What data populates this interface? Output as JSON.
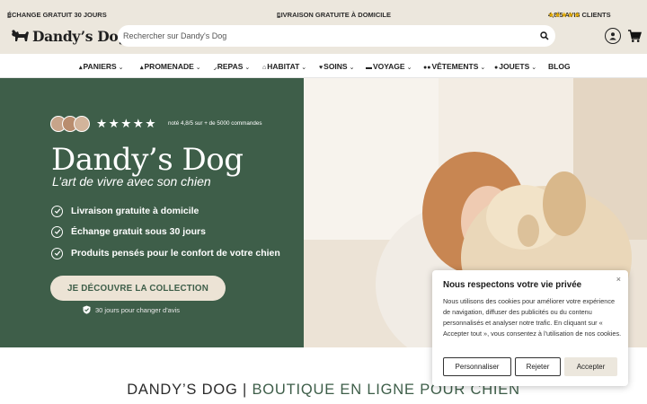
{
  "topbar": {
    "exchange": "ÉCHANGE GRATUIT 30 JOURS",
    "delivery": "LIVRAISON GRATUITE À DOMICILE",
    "reviews": "4,8/5 AVIS CLIENTS",
    "reviews_stars": "★★★★★"
  },
  "header": {
    "logo_text": "Dandy’s Dog",
    "search_placeholder": "Rechercher sur Dandy's Dog"
  },
  "nav": {
    "items": [
      {
        "label": "PANIERS",
        "icon": "basket-icon"
      },
      {
        "label": "PROMENADE",
        "icon": "walking-dog-icon"
      },
      {
        "label": "REPAS",
        "icon": "bowl-icon"
      },
      {
        "label": "HABITAT",
        "icon": "house-icon"
      },
      {
        "label": "SOINS",
        "icon": "heart-icon"
      },
      {
        "label": "VOYAGE",
        "icon": "car-icon"
      },
      {
        "label": "VÊTEMENTS",
        "icon": "bone-icon"
      },
      {
        "label": "JOUETS",
        "icon": "ball-icon"
      },
      {
        "label": "BLOG"
      }
    ]
  },
  "hero": {
    "stars": "★★★★★",
    "rating_note": "noté 4,8/5 sur + de 5000 commandes",
    "title": "Dandy’s Dog",
    "subtitle": "L’art de vivre avec son chien",
    "features": [
      "Livraison gratuite à domicile",
      "Échange gratuit sous 30 jours",
      "Produits pensés pour le confort de votre chien"
    ],
    "cta": "JE DÉCOUVRE LA COLLECTION",
    "guarantee": "30 jours pour changer d'avis"
  },
  "bottom": {
    "brand": "DANDY’S DOG |",
    "tagline": "BOUTIQUE EN LIGNE POUR CHIEN"
  },
  "cookie": {
    "title": "Nous respectons votre vie privée",
    "close": "×",
    "text": "Nous utilisons des cookies pour améliorer votre expérience de navigation, diffuser des publicités ou du contenu personnalisés et analyser notre trafic. En cliquant sur « Accepter tout », vous consentez à l'utilisation de nos cookies.",
    "customize": "Personnaliser",
    "reject": "Rejeter",
    "accept": "Accepter"
  },
  "colors": {
    "brand_green": "#3e5e49",
    "beige": "#ece7dd",
    "star_gold": "#e0a800"
  }
}
